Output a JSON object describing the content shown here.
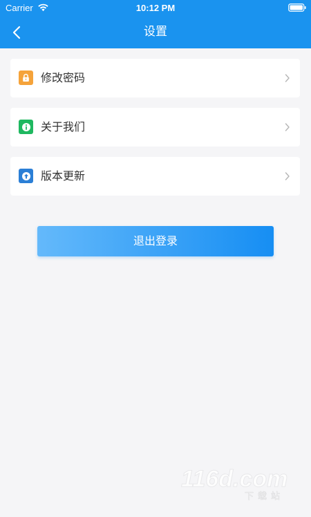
{
  "status_bar": {
    "carrier": "Carrier",
    "time": "10:12 PM",
    "wifi_icon": "wifi-icon",
    "battery_icon": "battery-icon"
  },
  "nav": {
    "title": "设置",
    "back_icon": "chevron-left-icon"
  },
  "settings": {
    "items": [
      {
        "label": "修改密码",
        "icon": "lock-icon",
        "icon_color": "#f5a33a"
      },
      {
        "label": "关于我们",
        "icon": "info-icon",
        "icon_color": "#1fb860"
      },
      {
        "label": "版本更新",
        "icon": "upload-icon",
        "icon_color": "#2b7fd6"
      }
    ]
  },
  "logout": {
    "label": "退出登录"
  },
  "watermark": {
    "brand": "116d.com",
    "subtitle": "下载站"
  },
  "colors": {
    "header": "#1a93ef",
    "background": "#f5f5f7",
    "card": "#ffffff",
    "text": "#333333",
    "chevron": "#b5b5b5",
    "button_gradient_start": "#64b9fb",
    "button_gradient_end": "#168ef3"
  }
}
